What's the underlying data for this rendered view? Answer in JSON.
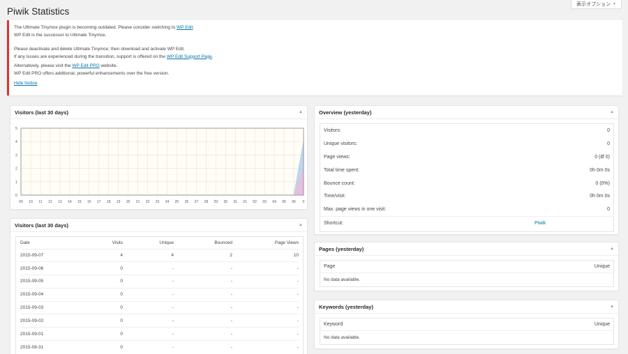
{
  "page_title": "Piwik Statistics",
  "screen_options": "表示オプション",
  "notice": {
    "line1_pre": "The Ultimate Tinymce plugin is becoming outdated. Please consider switching to ",
    "line1_link": "WP Edit",
    "line1_post": ".",
    "line2": "WP Edit is the successor to Ultimate Tinymce.",
    "line3": "Please deactivate and delete Ultimate Tinymce; then download and activate WP Edit.",
    "line4_pre": "If any issues are experienced during the transition, support is offered on the ",
    "line4_link": "WP Edit Support Page",
    "line4_post": ".",
    "line5_pre": "Alternatively, please visit the ",
    "line5_link": "WP Edit PRO",
    "line5_post": " website.",
    "line6": "WP Edit PRO offers additional, powerful enhancements over the free version.",
    "hide_link": "Hide Notice"
  },
  "visitors_chart_box": {
    "title": "Visitors (last 30 days)"
  },
  "visitors_table_box": {
    "title": "Visitors (last 30 days)",
    "headers": [
      "Date",
      "Visits",
      "Unique",
      "Bounced",
      "Page Views"
    ],
    "rows": [
      [
        "2015-09-07",
        "4",
        "4",
        "2",
        "10"
      ],
      [
        "2015-09-06",
        "0",
        "-",
        "-",
        "-"
      ],
      [
        "2015-09-05",
        "0",
        "-",
        "-",
        "-"
      ],
      [
        "2015-09-04",
        "0",
        "-",
        "-",
        "-"
      ],
      [
        "2015-09-03",
        "0",
        "-",
        "-",
        "-"
      ],
      [
        "2015-09-02",
        "0",
        "-",
        "-",
        "-"
      ],
      [
        "2015-09-01",
        "0",
        "-",
        "-",
        "-"
      ],
      [
        "2015-08-31",
        "0",
        "-",
        "-",
        "-"
      ]
    ]
  },
  "overview_box": {
    "title": "Overview (yesterday)",
    "rows": [
      {
        "label": "Visitors:",
        "value": "0"
      },
      {
        "label": "Unique visitors:",
        "value": "0"
      },
      {
        "label": "Page views:",
        "value": "0 (Ø 0)"
      },
      {
        "label": "Total time spent:",
        "value": "0h 0m 0s"
      },
      {
        "label": "Bounce count:",
        "value": "0 (0%)"
      },
      {
        "label": "Time/visit:",
        "value": "0h 0m 0s"
      },
      {
        "label": "Max. page views in one visit:",
        "value": "0"
      }
    ],
    "shortcut_label": "Shortcut:",
    "shortcut_link": "Piwik"
  },
  "pages_box": {
    "title": "Pages (yesterday)",
    "col1": "Page",
    "col2": "Unique",
    "empty": "No data available."
  },
  "keywords_box": {
    "title": "Keywords (yesterday)",
    "col1": "Keyword",
    "col2": "Unique",
    "empty": "No data available."
  },
  "chart_data": {
    "type": "area",
    "categories": [
      "09",
      "10",
      "11",
      "12",
      "13",
      "14",
      "15",
      "16",
      "17",
      "18",
      "19",
      "20",
      "21",
      "22",
      "23",
      "24",
      "25",
      "26",
      "27",
      "28",
      "29",
      "30",
      "31",
      "01",
      "02",
      "03",
      "04",
      "05",
      "06",
      "0"
    ],
    "series": [
      {
        "values": [
          0,
          0,
          0,
          0,
          0,
          0,
          0,
          0,
          0,
          0,
          0,
          0,
          0,
          0,
          0,
          0,
          0,
          0,
          0,
          0,
          0,
          0,
          0,
          0,
          0,
          0,
          0,
          0,
          0,
          4
        ],
        "color": "#a8c8ee"
      },
      {
        "values": [
          0,
          0,
          0,
          0,
          0,
          0,
          0,
          0,
          0,
          0,
          0,
          0,
          0,
          0,
          0,
          0,
          0,
          0,
          0,
          0,
          0,
          0,
          0,
          0,
          0,
          0,
          0,
          0,
          0,
          2
        ],
        "color": "#f0b8d8"
      }
    ],
    "ylim": [
      0,
      5
    ],
    "yticks": [
      "0",
      "1",
      "2",
      "3",
      "4",
      "5"
    ],
    "grid": true,
    "colors": {
      "plot_bg": "#fffdf5",
      "grid": "#e8e4d8",
      "frame": "#888888"
    }
  }
}
